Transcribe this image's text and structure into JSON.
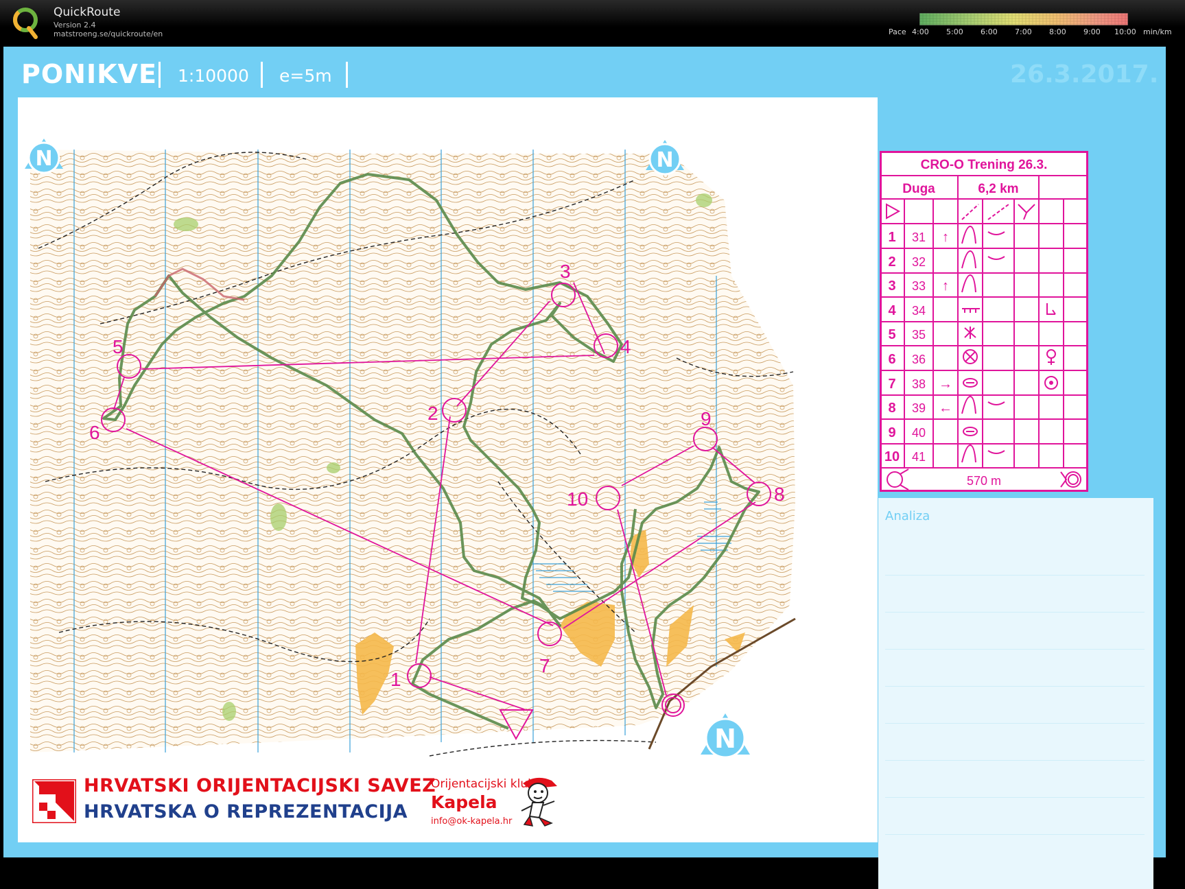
{
  "app": {
    "name": "QuickRoute",
    "version": "Version 2.4",
    "url": "matstroeng.se/quickroute/en"
  },
  "pace_legend": {
    "title": "Pace",
    "ticks": [
      "4:00",
      "5:00",
      "6:00",
      "7:00",
      "8:00",
      "9:00",
      "10:00"
    ],
    "unit": "min/km",
    "colors": [
      "#66b266",
      "#a8d070",
      "#e8e070",
      "#f0c070",
      "#f09080",
      "#f07070"
    ]
  },
  "map": {
    "title": "PONIKVE",
    "scale": "1:10000",
    "equidistance": "e=5m",
    "date": "26.3.2017.",
    "north_label": "N",
    "course_color": "#e0149b",
    "route_color": "#5a8a4a",
    "controls": [
      {
        "label": "1"
      },
      {
        "label": "2"
      },
      {
        "label": "3"
      },
      {
        "label": "4"
      },
      {
        "label": "5"
      },
      {
        "label": "6"
      },
      {
        "label": "7"
      },
      {
        "label": "8"
      },
      {
        "label": "9"
      },
      {
        "label": "10"
      }
    ]
  },
  "control_descriptions": {
    "event": "CRO-O Trening 26.3.",
    "course": "Duga",
    "length": "6,2 km",
    "finish_distance": "570 m",
    "rows": [
      {
        "num": "1",
        "code": "31",
        "dir": "↑"
      },
      {
        "num": "2",
        "code": "32",
        "dir": ""
      },
      {
        "num": "3",
        "code": "33",
        "dir": "↑"
      },
      {
        "num": "4",
        "code": "34",
        "dir": ""
      },
      {
        "num": "5",
        "code": "35",
        "dir": ""
      },
      {
        "num": "6",
        "code": "36",
        "dir": ""
      },
      {
        "num": "7",
        "code": "38",
        "dir": "→"
      },
      {
        "num": "8",
        "code": "39",
        "dir": "←"
      },
      {
        "num": "9",
        "code": "40",
        "dir": ""
      },
      {
        "num": "10",
        "code": "41",
        "dir": ""
      }
    ]
  },
  "analysis": {
    "title": "Analiza"
  },
  "sponsors": {
    "federation_line1": "HRVATSKI ORIJENTACIJSKI SAVEZ",
    "federation_line2": "HRVATSKA O REPREZENTACIJA",
    "club_line1": "Orijentacijski klub",
    "club_line2": "Kapela",
    "club_email": "info@ok-kapela.hr"
  }
}
